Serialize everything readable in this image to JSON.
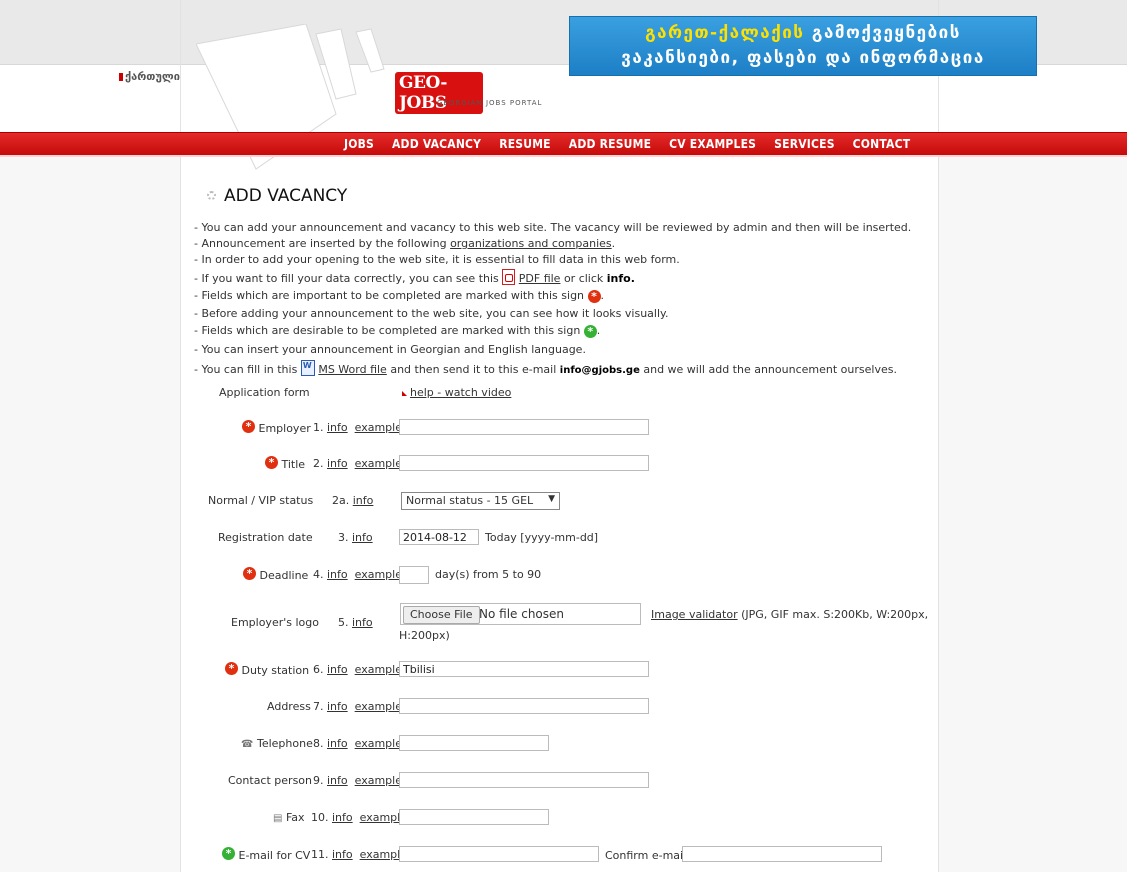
{
  "header": {
    "lang_link": "ქართული",
    "logo_text": "GEO-JOBS",
    "logo_subtitle": "GEORGIAN JOBS PORTAL",
    "banner_line1_a": "გარეთ-ქალაქის",
    "banner_line1_b": "გამოქვეყნების",
    "banner_line2": "ვაკანსიები, ფასები და ინფორმაცია"
  },
  "nav": {
    "items": [
      "JOBS",
      "ADD VACANCY",
      "RESUME",
      "ADD RESUME",
      "CV EXAMPLES",
      "SERVICES",
      "CONTACT"
    ]
  },
  "page": {
    "title": "ADD VACANCY",
    "intro": {
      "l1": "- You can add your announcement and vacancy to this web site. The vacancy will be reviewed by admin and then will be inserted.",
      "l2a": "- Announcement are inserted by the following",
      "l2_link": "organizations and companies",
      "l2b": ".",
      "l3": "- In order to add your opening to the web site, it is essential to fill data in this web form.",
      "l4a": "- If you want to fill your data correctly, you can see this",
      "l4_link": "PDF file",
      "l4b": "or click",
      "l4_bold": "info.",
      "l5a": "- Fields which are important to be completed are marked with this sign",
      "l6": "- Before adding your announcement to the web site, you can see how it looks visually.",
      "l7a": "- Fields which are desirable to be completed are marked with this sign",
      "l8": "- You can insert your announcement in Georgian and English language.",
      "l9a": "- You can fill in this",
      "l9_link": "MS Word file",
      "l9b": "and then send it to this e-mail",
      "l9_email": "info@gjobs.ge",
      "l9c": "and we will add the announcement ourselves."
    },
    "form_title": "Application form",
    "help_link": "help - watch video"
  },
  "form": {
    "info": "info",
    "example": "example",
    "employer": {
      "label": "Employer",
      "num": "1."
    },
    "title": {
      "label": "Title",
      "num": "2."
    },
    "status": {
      "label": "Normal / VIP status",
      "num": "2a.",
      "value": "Normal status - 15 GEL"
    },
    "regdate": {
      "label": "Registration date",
      "num": "3.",
      "value": "2014-08-12",
      "hint": "Today [yyyy-mm-dd]"
    },
    "deadline": {
      "label": "Deadline",
      "num": "4.",
      "hint": "day(s) from 5 to 90"
    },
    "logo": {
      "label": "Employer's logo",
      "num": "5.",
      "button": "Choose File",
      "status": "No file chosen",
      "validator": "Image validator",
      "note": "(JPG, GIF max. S:200Kb, W:200px,",
      "note2": "H:200px)"
    },
    "duty": {
      "label": "Duty station",
      "num": "6.",
      "value": "Tbilisi"
    },
    "address": {
      "label": "Address",
      "num": "7."
    },
    "telephone": {
      "label": "Telephone",
      "num": "8."
    },
    "contact": {
      "label": "Contact person",
      "num": "9."
    },
    "fax": {
      "label": "Fax",
      "num": "10."
    },
    "email": {
      "label": "E-mail for CV",
      "num": "11.",
      "confirm": "Confirm e-mail"
    }
  }
}
